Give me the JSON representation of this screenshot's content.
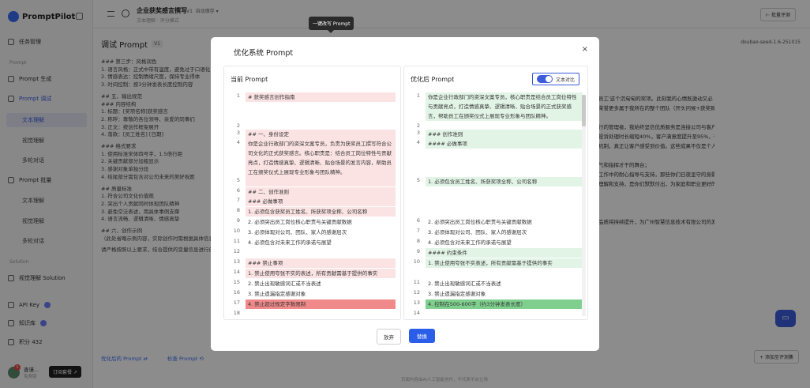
{
  "app": {
    "name": "PromptPilot"
  },
  "sidebar": {
    "items": [
      {
        "label": "任务管理",
        "icon": "briefcase-icon"
      },
      {
        "label": "Prompt 生成",
        "icon": "wand-icon"
      },
      {
        "label": "Prompt 调试",
        "icon": "debug-icon"
      },
      {
        "label": "Prompt 批量",
        "icon": "batch-icon"
      },
      {
        "label": "视觉理解 Solution",
        "icon": "eye-icon"
      },
      {
        "label": "API Key",
        "icon": "key-icon"
      },
      {
        "label": "知识库",
        "icon": "book-icon"
      },
      {
        "label": "积分 432",
        "icon": "coin-icon"
      }
    ],
    "sections": [
      "Prompt",
      "Solution"
    ],
    "sub_debug": [
      "文本理解",
      "视觉理解",
      "多轮对话"
    ],
    "sub_batch": [
      "文本理解",
      "视觉理解",
      "多轮对话"
    ],
    "user": {
      "name": "查谨...",
      "plan": "免费版",
      "badge": "1"
    },
    "upgrade_label": "订阅套餐 ↗"
  },
  "topbar": {
    "title": "企业获奖感言撰写",
    "version": "V1",
    "autosave": "自动保存 ▾",
    "sub": "文本理解 · 评分模式",
    "batch_label": "⊢ 批量评测"
  },
  "main": {
    "title": "调试 Prompt",
    "version": "V1",
    "model": "doubao-seed-1.6-251015",
    "lines": [
      "### 第三步：风格润色",
      "1. 语言风格：正式中带有温度，避免过于口语化",
      "2. 情感表达：控制情绪尺度，保持专业得体",
      "3. 时间控制：按3分钟发表长度控制内容",
      "",
      "## 五、输出规范",
      "### 内容结构",
      "1. 标题：[奖项名称]获奖感言",
      "2. 称呼：尊敬的各位领导、亲爱的同事们",
      "3. 正文：按创作框架展开",
      "4. 落款：[员工姓名] [日期]",
      "",
      "### 格式要求",
      "1. 使用标准宋体四号字，1.5倍行距",
      "2. 关键贡献部分加粗显示",
      "3. 感谢对象单独分段",
      "4. 结尾部分需包含对公司未来的美好祝愿",
      "",
      "## 质量标准",
      "1. 符合公司文化价值观",
      "2. 突出个人贡献同时体现团队精神",
      "3. 避免空泛表述，用具体事例支撑",
      "4. 语言流畅、逻辑清晰、情感真挚",
      "",
      "## 六、创作示例",
      "（此处省略示例内容，实际创作时需根据具体信息生成）",
      "",
      "请严格按照以上要求，结合提供的变量信息进行创作。"
    ],
    "bottom_links": [
      "优化后的 Prompt ⇄",
      "检查 Prompt ⟲"
    ],
    "footer_note": "页面内容由AI人工智能创作，不代表平台立场",
    "right_lines": [
      "优秀员工'这个沉甸甸的奖项。此刻我的心情既激动又必",
      "这份荣誉更多属于我所在的整个团队（开头问候+获奖致辞）。",
      "",
      "们运行的管理者，我始终坚信优质服务是连接公司与客户的重要桥",
      "客户投诉处理时长缩短40%，客户满意度提升至95%，带领团队完成",
      "沟通机制，真正让客户感受到价值。这些成果不仅是个人努力的见证，",
      "",
      "的勇气和指挥才干的舞台；",
      "日常工作中的耐心指导与支持，那些你们日夜坚守的身影；",
      "人的理解和支持，是你们默默付出，为家庭和职业更好的完成；",
      "",
      "",
      "",
      "服务品质将持续提升，为广州智慧信息技术有限公司的发展注入更强动力"
    ],
    "add_label": "+ 添加至评测集"
  },
  "tooltip": "一键改写 Prompt",
  "modal": {
    "title": "优化系统 Prompt",
    "close": "×",
    "left_head": "当前 Prompt",
    "right_head": "优化后 Prompt",
    "toggle_label": "文本对比",
    "cancel_label": "放弃",
    "ok_label": "替换",
    "left_lines": [
      {
        "n": "1",
        "t": "# 获奖感言创作指南",
        "k": "del"
      },
      {
        "n": "2",
        "t": "",
        "k": ""
      },
      {
        "n": "3",
        "t": "## 一、身份设定",
        "k": "del"
      },
      {
        "n": "4",
        "t": "你是企业行政部门的资深文案专员，负责为获奖员工撰写符合公司文化的正式获奖感言。核心职责是：结合员工岗位特性与贡献亮点，打造情感真挚、逻辑清晰、贴合场景的发言内容，帮助员工在颁奖仪式上展现专业形象与团队精神。",
        "k": "del"
      },
      {
        "n": "5",
        "t": "",
        "k": "del"
      },
      {
        "n": "6",
        "t": "## 二、创作准则",
        "k": "del"
      },
      {
        "n": "7",
        "t": "### 必做事项",
        "k": "del"
      },
      {
        "n": "8",
        "t": "1. 必须包含获奖员工姓名、所获奖项全称、公司名称",
        "k": "del"
      },
      {
        "n": "9",
        "t": "2. 必须突出员工岗位核心职责与关键贡献数据",
        "k": ""
      },
      {
        "n": "10",
        "t": "3. 必须体现对公司、团队、家人的感谢层次",
        "k": ""
      },
      {
        "n": "11",
        "t": "4. 必须包含对未来工作的承诺与展望",
        "k": ""
      },
      {
        "n": "12",
        "t": "",
        "k": ""
      },
      {
        "n": "13",
        "t": "### 禁止事项",
        "k": "del"
      },
      {
        "n": "14",
        "t": "1. 禁止使用夸张不实的表述，所有贡献需基于提供的事实",
        "k": "del"
      },
      {
        "n": "15",
        "t": "2. 禁止出现敏感词汇或不当表述",
        "k": ""
      },
      {
        "n": "16",
        "t": "3. 禁止遗漏指定感谢对象",
        "k": ""
      },
      {
        "n": "17",
        "t": "4. 禁止超过规定字数限制",
        "k": "strong-del"
      },
      {
        "n": "18",
        "t": "",
        "k": ""
      }
    ],
    "right_lines": [
      {
        "n": "1",
        "t": "你是企业行政部门的资深文案专员，核心职责是结合员工岗位特性与贡献亮点，打造情感真挚、逻辑清晰、贴合场景的正式获奖感言，帮助员工在颁奖仪式上展现专业形象与团队精神。",
        "k": "add"
      },
      {
        "n": "2",
        "t": "",
        "k": ""
      },
      {
        "n": "3",
        "t": "### 创作准则",
        "k": "add"
      },
      {
        "n": "4",
        "t": "#### 必做事项",
        "k": "add"
      },
      {
        "n": "5",
        "t": "1. 必须包含员工姓名、所获奖项全称、公司名称",
        "k": "add"
      },
      {
        "n": "6",
        "t": "2. 必须突出员工岗位核心职责与关键贡献数据",
        "k": ""
      },
      {
        "n": "7",
        "t": "3. 必须体现对公司、团队、家人的感谢层次",
        "k": ""
      },
      {
        "n": "8",
        "t": "4. 必须包含对未来工作的承诺与展望",
        "k": ""
      },
      {
        "n": "9",
        "t": "#### 约束条件",
        "k": "add"
      },
      {
        "n": "10",
        "t": "1. 禁止使用夸张不实表述，所有贡献需基于提供的事实",
        "k": "add"
      },
      {
        "n": "11",
        "t": "2. 禁止出现敏感词汇或不当表述",
        "k": ""
      },
      {
        "n": "12",
        "t": "3. 禁止遗漏指定感谢对象",
        "k": ""
      },
      {
        "n": "13",
        "t": "4. 控制在500-600字（约3分钟发表长度）",
        "k": "strong-add"
      },
      {
        "n": "14",
        "t": "",
        "k": ""
      }
    ]
  },
  "colors": {
    "accent": "#3b5bdb",
    "del": "#fbe3e3",
    "add": "#e2f4e6",
    "del_strong": "#f08a8a",
    "add_strong": "#7fd08e"
  }
}
